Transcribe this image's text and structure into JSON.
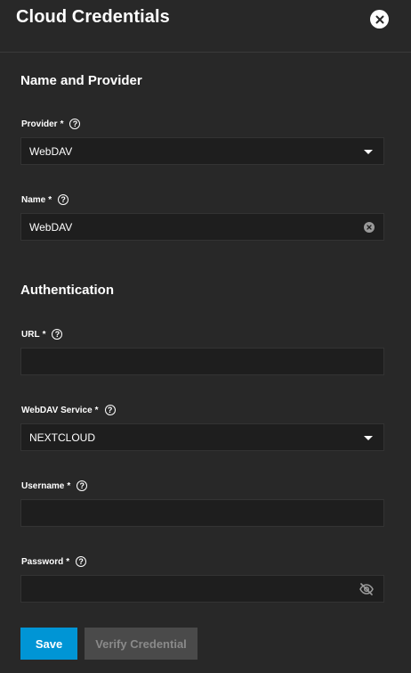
{
  "dialog": {
    "title": "Cloud Credentials"
  },
  "sections": {
    "name_provider": "Name and Provider",
    "authentication": "Authentication"
  },
  "fields": {
    "provider": {
      "label": "Provider",
      "required": "*",
      "value": "WebDAV"
    },
    "name": {
      "label": "Name",
      "required": "*",
      "value": "WebDAV"
    },
    "url": {
      "label": "URL",
      "required": "*",
      "value": ""
    },
    "webdav_service": {
      "label": "WebDAV Service",
      "required": "*",
      "value": "NEXTCLOUD"
    },
    "username": {
      "label": "Username",
      "required": "*",
      "value": ""
    },
    "password": {
      "label": "Password",
      "required": "*",
      "value": ""
    }
  },
  "help_glyph": "?",
  "buttons": {
    "save": "Save",
    "verify": "Verify Credential"
  },
  "icons": {
    "close": "close-icon",
    "help": "help-circle-icon",
    "dropdown": "caret-down-icon",
    "clear": "clear-icon",
    "visibility": "eye-off-icon"
  },
  "colors": {
    "background": "#282828",
    "input_background": "#1e1e1e",
    "primary": "#0095d5",
    "disabled_button": "#4a4a4a"
  }
}
